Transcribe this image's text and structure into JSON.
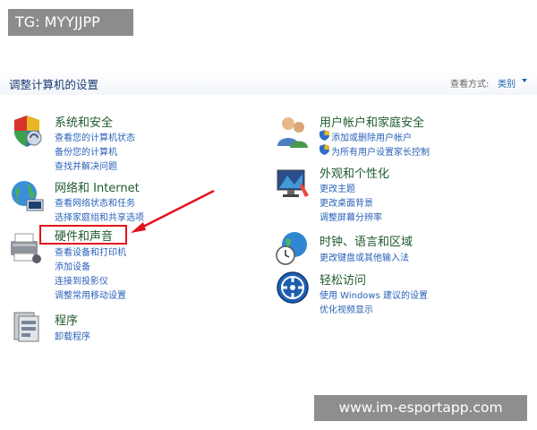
{
  "watermarks": {
    "top_left": "TG: MYYJJPP",
    "bottom_right": "www.im-esportapp.com"
  },
  "header": {
    "title": "调整计算机的设置",
    "view_by_label": "查看方式:",
    "view_by_value": "类别"
  },
  "categories": {
    "system": {
      "title": "系统和安全",
      "icon": "shield-icon",
      "links": [
        "查看您的计算机状态",
        "备份您的计算机",
        "查找并解决问题"
      ]
    },
    "network": {
      "title": "网络和 Internet",
      "icon": "network-globe-icon",
      "links": [
        "查看网络状态和任务",
        "选择家庭组和共享选项"
      ]
    },
    "hardware": {
      "title": "硬件和声音",
      "icon": "printer-icon",
      "links": [
        "查看设备和打印机",
        "添加设备",
        "连接到投影仪",
        "调整常用移动设置"
      ]
    },
    "programs": {
      "title": "程序",
      "icon": "programs-icon",
      "links": [
        "卸载程序"
      ]
    },
    "user_accounts": {
      "title": "用户帐户和家庭安全",
      "icon": "users-icon",
      "links": [
        "添加或删除用户帐户",
        "为所有用户设置家长控制"
      ]
    },
    "appearance": {
      "title": "外观和个性化",
      "icon": "monitor-icon",
      "links": [
        "更改主题",
        "更改桌面背景",
        "调整屏幕分辨率"
      ]
    },
    "clock": {
      "title": "时钟、语言和区域",
      "icon": "clock-globe-icon",
      "links": [
        "更改键盘或其他输入法"
      ]
    },
    "ease": {
      "title": "轻松访问",
      "icon": "ease-of-access-icon",
      "links": [
        "使用 Windows 建议的设置",
        "优化视频显示"
      ]
    }
  },
  "annotation": {
    "highlight_color": "#e1141b"
  },
  "colors": {
    "title_green": "#1e5a2e",
    "link_blue": "#2a62b8",
    "header_blue": "#1b3a73"
  }
}
